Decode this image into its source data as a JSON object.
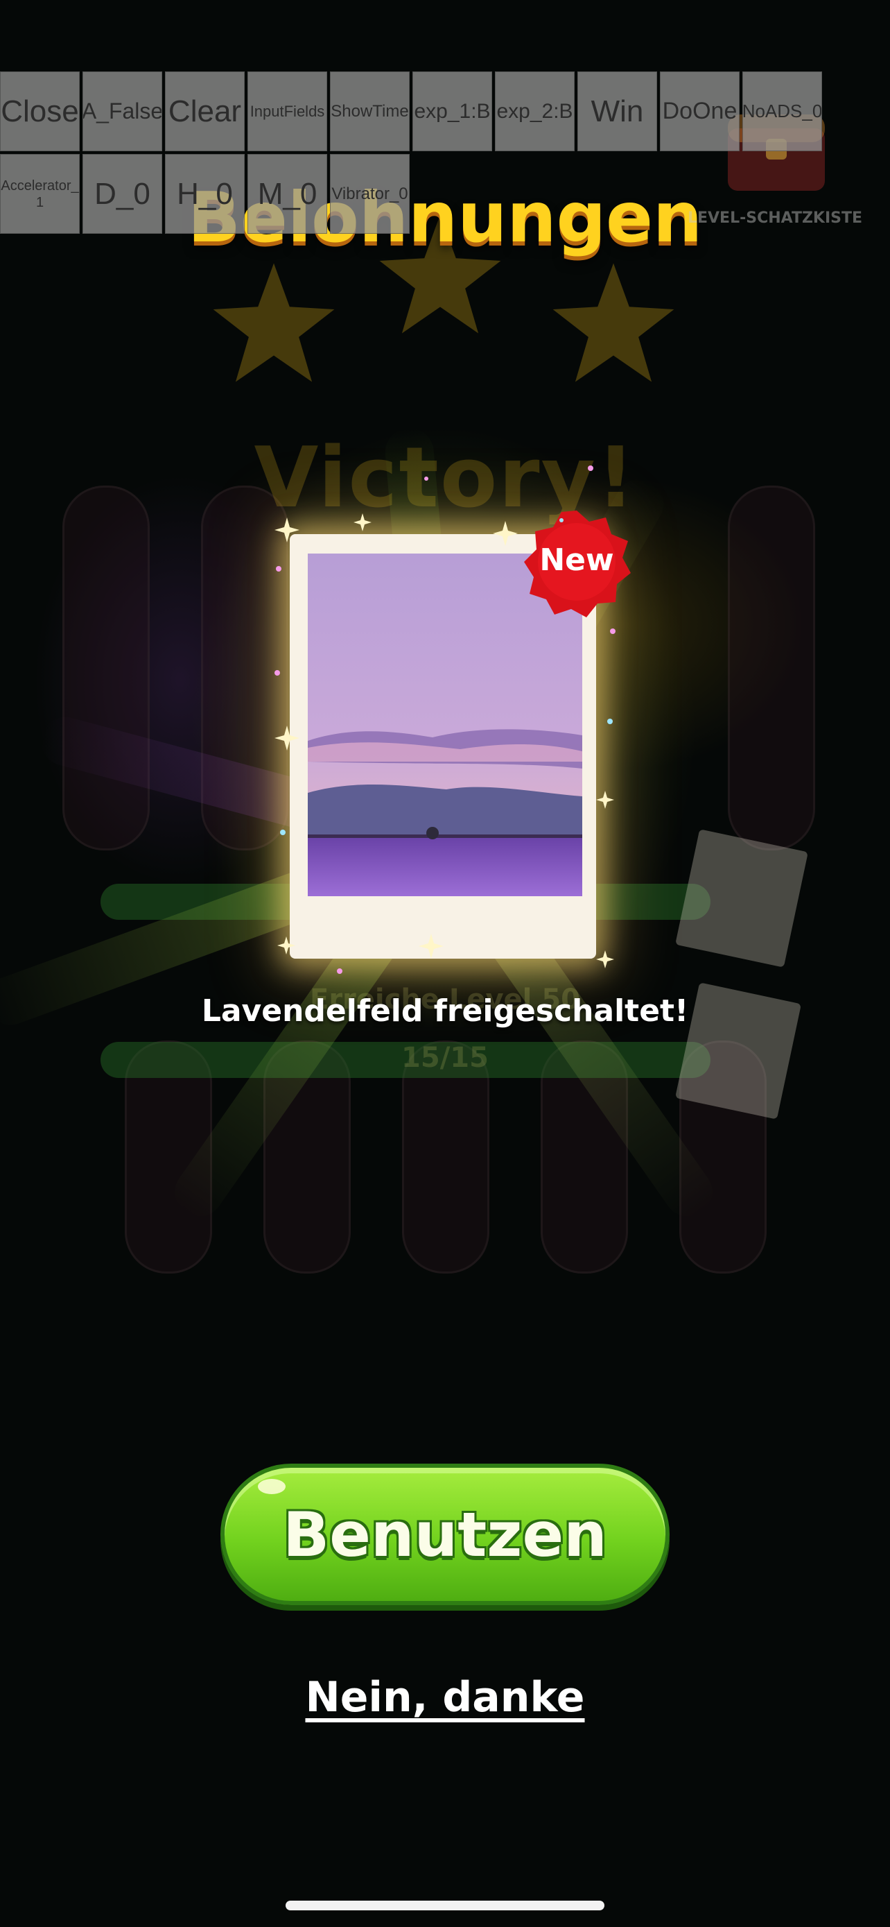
{
  "debug_toolbar": {
    "row1": [
      "Close",
      "A_False",
      "Clear",
      "InputFields",
      "ShowTime",
      "exp_1:B",
      "exp_2:B",
      "Win",
      "DoOne",
      "NoADS_0"
    ],
    "row2": [
      "Accelerator_\n1",
      "D_0",
      "H_0",
      "M_0",
      "Vibrator_0"
    ]
  },
  "header": {
    "title": "Belohnungen",
    "chest_label": "LEVEL-SCHATZKISTE"
  },
  "background": {
    "victory_text": "Victory!",
    "level_text": "Erreiche Level 50",
    "progress_text": "15/15"
  },
  "reward": {
    "badge": "New",
    "unlocked_text": "Lavendelfeld freigeschaltet!",
    "photo_icon": "lavender-field-photo"
  },
  "actions": {
    "use_label": "Benutzen",
    "decline_label": "Nein, danke"
  },
  "colors": {
    "title": "#ffd21f",
    "button_green": "#72d21e",
    "badge_red": "#d9121a",
    "background": "#050807"
  }
}
